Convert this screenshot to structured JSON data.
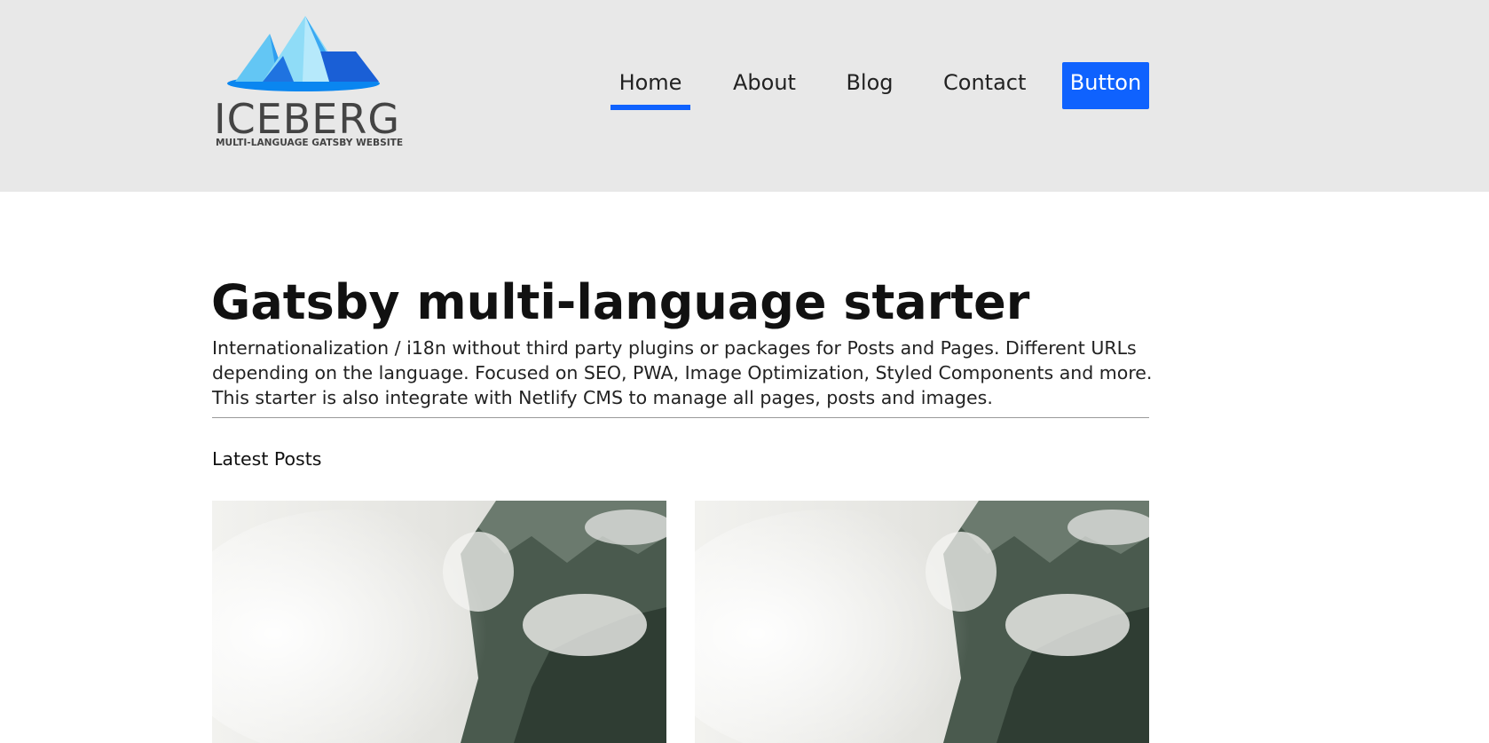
{
  "brand": {
    "name": "ICEBERG",
    "tagline": "MULTI-LANGUAGE GATSBY WEBSITE",
    "colors": {
      "header_bg": "#e8e8e8",
      "accent": "#0f62fe",
      "logo_light": "#8fdcf7",
      "logo_mid": "#38b5f0",
      "logo_dark": "#1565d8"
    }
  },
  "nav": {
    "items": [
      {
        "label": "Home",
        "active": true
      },
      {
        "label": "About",
        "active": false
      },
      {
        "label": "Blog",
        "active": false
      },
      {
        "label": "Contact",
        "active": false
      }
    ],
    "button_label": "Button"
  },
  "hero": {
    "title": "Gatsby multi-language starter",
    "description": "Internationalization / i18n without third party plugins or packages for Posts and Pages. Different URLs depending on the language. Focused on SEO, PWA, Image Optimization, Styled Components and more. This starter is also integrate with Netlify CMS to manage all pages, posts and images."
  },
  "posts": {
    "section_label": "Latest Posts",
    "items": [
      {
        "image": "misty-mountain-forest"
      },
      {
        "image": "misty-mountain-forest"
      }
    ]
  }
}
